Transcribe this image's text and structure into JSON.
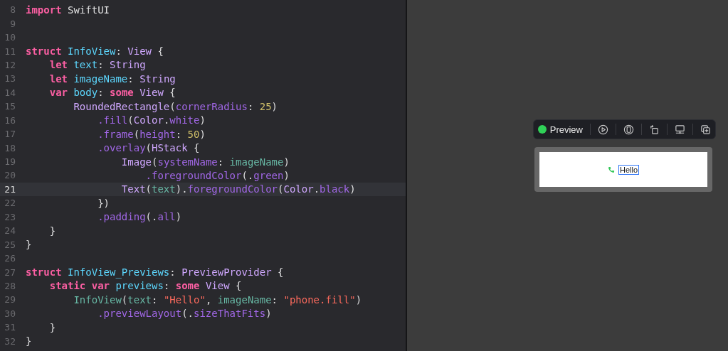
{
  "editor": {
    "lines": [
      {
        "number": "8",
        "highlighted": false,
        "tokens": [
          {
            "kind": "kw",
            "text": "import"
          },
          {
            "kind": "plain",
            "text": " SwiftUI"
          }
        ]
      },
      {
        "number": "9",
        "highlighted": false
      },
      {
        "number": "10",
        "highlighted": false
      },
      {
        "number": "11",
        "highlighted": false,
        "tokens": [
          {
            "kind": "kw",
            "text": "struct"
          },
          {
            "kind": "decl",
            "text": " InfoView"
          },
          {
            "kind": "plain",
            "text": ": "
          },
          {
            "kind": "type",
            "text": "View"
          },
          {
            "kind": "plain",
            "text": " {"
          }
        ]
      },
      {
        "number": "12",
        "highlighted": false,
        "tokens": [
          {
            "kind": "kw",
            "text": "    let"
          },
          {
            "kind": "decl",
            "text": " text"
          },
          {
            "kind": "plain",
            "text": ": "
          },
          {
            "kind": "type",
            "text": "String"
          }
        ]
      },
      {
        "number": "13",
        "highlighted": false,
        "tokens": [
          {
            "kind": "kw",
            "text": "    let"
          },
          {
            "kind": "decl",
            "text": " imageName"
          },
          {
            "kind": "plain",
            "text": ": "
          },
          {
            "kind": "type",
            "text": "String"
          }
        ]
      },
      {
        "number": "14",
        "highlighted": false,
        "tokens": [
          {
            "kind": "kw",
            "text": "    var"
          },
          {
            "kind": "decl",
            "text": " body"
          },
          {
            "kind": "plain",
            "text": ": "
          },
          {
            "kind": "kw",
            "text": "some"
          },
          {
            "kind": "type",
            "text": " View"
          },
          {
            "kind": "plain",
            "text": " {"
          }
        ]
      },
      {
        "number": "15",
        "highlighted": false,
        "tokens": [
          {
            "kind": "type",
            "text": "        RoundedRectangle"
          },
          {
            "kind": "plain",
            "text": "("
          },
          {
            "kind": "sys",
            "text": "cornerRadius"
          },
          {
            "kind": "plain",
            "text": ": "
          },
          {
            "kind": "num",
            "text": "25"
          },
          {
            "kind": "plain",
            "text": ")"
          }
        ]
      },
      {
        "number": "16",
        "highlighted": false,
        "tokens": [
          {
            "kind": "sys",
            "text": "            .fill"
          },
          {
            "kind": "plain",
            "text": "("
          },
          {
            "kind": "type",
            "text": "Color"
          },
          {
            "kind": "plain",
            "text": "."
          },
          {
            "kind": "sys",
            "text": "white"
          },
          {
            "kind": "plain",
            "text": ")"
          }
        ]
      },
      {
        "number": "17",
        "highlighted": false,
        "tokens": [
          {
            "kind": "sys",
            "text": "            .frame"
          },
          {
            "kind": "plain",
            "text": "("
          },
          {
            "kind": "sys",
            "text": "height"
          },
          {
            "kind": "plain",
            "text": ": "
          },
          {
            "kind": "num",
            "text": "50"
          },
          {
            "kind": "plain",
            "text": ")"
          }
        ]
      },
      {
        "number": "18",
        "highlighted": false,
        "tokens": [
          {
            "kind": "sys",
            "text": "            .overlay"
          },
          {
            "kind": "plain",
            "text": "("
          },
          {
            "kind": "type",
            "text": "HStack"
          },
          {
            "kind": "plain",
            "text": " {"
          }
        ]
      },
      {
        "number": "19",
        "highlighted": false,
        "tokens": [
          {
            "kind": "type",
            "text": "                Image"
          },
          {
            "kind": "plain",
            "text": "("
          },
          {
            "kind": "sys",
            "text": "systemName"
          },
          {
            "kind": "plain",
            "text": ": "
          },
          {
            "kind": "ref",
            "text": "imageName"
          },
          {
            "kind": "plain",
            "text": ")"
          }
        ]
      },
      {
        "number": "20",
        "highlighted": false,
        "tokens": [
          {
            "kind": "sys",
            "text": "                    .foregroundColor"
          },
          {
            "kind": "plain",
            "text": "(."
          },
          {
            "kind": "sys",
            "text": "green"
          },
          {
            "kind": "plain",
            "text": ")"
          }
        ]
      },
      {
        "number": "21",
        "highlighted": true,
        "tokens": [
          {
            "kind": "type",
            "text": "                Text"
          },
          {
            "kind": "plain",
            "text": "("
          },
          {
            "kind": "ref",
            "text": "text"
          },
          {
            "kind": "plain",
            "text": ")."
          },
          {
            "kind": "sys",
            "text": "foregroundColor"
          },
          {
            "kind": "plain",
            "text": "("
          },
          {
            "kind": "type",
            "text": "Color"
          },
          {
            "kind": "plain",
            "text": "."
          },
          {
            "kind": "sys",
            "text": "black"
          },
          {
            "kind": "plain",
            "text": ")"
          }
        ]
      },
      {
        "number": "22",
        "highlighted": false,
        "tokens": [
          {
            "kind": "plain",
            "text": "            })"
          }
        ]
      },
      {
        "number": "23",
        "highlighted": false,
        "tokens": [
          {
            "kind": "sys",
            "text": "            .padding"
          },
          {
            "kind": "plain",
            "text": "(."
          },
          {
            "kind": "sys",
            "text": "all"
          },
          {
            "kind": "plain",
            "text": ")"
          }
        ]
      },
      {
        "number": "24",
        "highlighted": false,
        "tokens": [
          {
            "kind": "plain",
            "text": "    }"
          }
        ]
      },
      {
        "number": "25",
        "highlighted": false,
        "tokens": [
          {
            "kind": "plain",
            "text": "}"
          }
        ]
      },
      {
        "number": "26",
        "highlighted": false
      },
      {
        "number": "27",
        "highlighted": false,
        "tokens": [
          {
            "kind": "kw",
            "text": "struct"
          },
          {
            "kind": "decl",
            "text": " InfoView_Previews"
          },
          {
            "kind": "plain",
            "text": ": "
          },
          {
            "kind": "type",
            "text": "PreviewProvider"
          },
          {
            "kind": "plain",
            "text": " {"
          }
        ]
      },
      {
        "number": "28",
        "highlighted": false,
        "tokens": [
          {
            "kind": "kw",
            "text": "    static var"
          },
          {
            "kind": "decl",
            "text": " previews"
          },
          {
            "kind": "plain",
            "text": ": "
          },
          {
            "kind": "kw",
            "text": "some"
          },
          {
            "kind": "type",
            "text": " View"
          },
          {
            "kind": "plain",
            "text": " {"
          }
        ]
      },
      {
        "number": "29",
        "highlighted": false,
        "tokens": [
          {
            "kind": "ref",
            "text": "        InfoView"
          },
          {
            "kind": "plain",
            "text": "("
          },
          {
            "kind": "ref",
            "text": "text"
          },
          {
            "kind": "plain",
            "text": ": "
          },
          {
            "kind": "str",
            "text": "\"Hello\""
          },
          {
            "kind": "plain",
            "text": ", "
          },
          {
            "kind": "ref",
            "text": "imageName"
          },
          {
            "kind": "plain",
            "text": ": "
          },
          {
            "kind": "str",
            "text": "\"phone.fill\""
          },
          {
            "kind": "plain",
            "text": ")"
          }
        ]
      },
      {
        "number": "30",
        "highlighted": false,
        "tokens": [
          {
            "kind": "sys",
            "text": "            .previewLayout"
          },
          {
            "kind": "plain",
            "text": "(."
          },
          {
            "kind": "sys",
            "text": "sizeThatFits"
          },
          {
            "kind": "plain",
            "text": ")"
          }
        ]
      },
      {
        "number": "31",
        "highlighted": false,
        "tokens": [
          {
            "kind": "plain",
            "text": "    }"
          }
        ]
      },
      {
        "number": "32",
        "highlighted": false,
        "tokens": [
          {
            "kind": "plain",
            "text": "}"
          }
        ]
      }
    ]
  },
  "preview": {
    "live": true,
    "label": "Preview",
    "content": {
      "text": "Hello",
      "selected": true
    }
  }
}
